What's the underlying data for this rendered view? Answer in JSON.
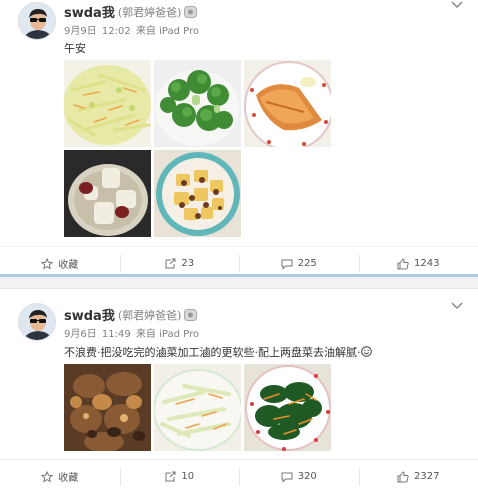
{
  "posts": [
    {
      "username": "swda我",
      "remark": "(郭君婷爸爸)",
      "date": "9月9日",
      "time": "12:02",
      "source": "来自 iPad Pro",
      "text": "午安",
      "images": [
        "cabbage-salad",
        "broccoli",
        "grilled-salmon",
        "radish-soup",
        "tofu-meat"
      ],
      "actions": {
        "favorite": "收藏",
        "repost": "23",
        "comment": "225",
        "like": "1243"
      }
    },
    {
      "username": "swda我",
      "remark": "(郭君婷爸爸)",
      "date": "9月6日",
      "time": "11:49",
      "source": "来自 iPad Pro",
      "text": "不浪费·把没吃完的滷菜加工滷的更软些·配上两盘菜去油解腻·",
      "images": [
        "braised-pork",
        "cabbage-carrot",
        "spinach-carrot"
      ],
      "actions": {
        "favorite": "收藏",
        "repost": "10",
        "comment": "320",
        "like": "2327"
      }
    }
  ],
  "icons": {
    "favorite": "star-icon",
    "repost": "repost-icon",
    "comment": "comment-icon",
    "like": "thumbs-up-icon",
    "menu": "chevron-down-icon",
    "badge": "member-badge-icon",
    "emoji": "smile-emoji-icon"
  }
}
